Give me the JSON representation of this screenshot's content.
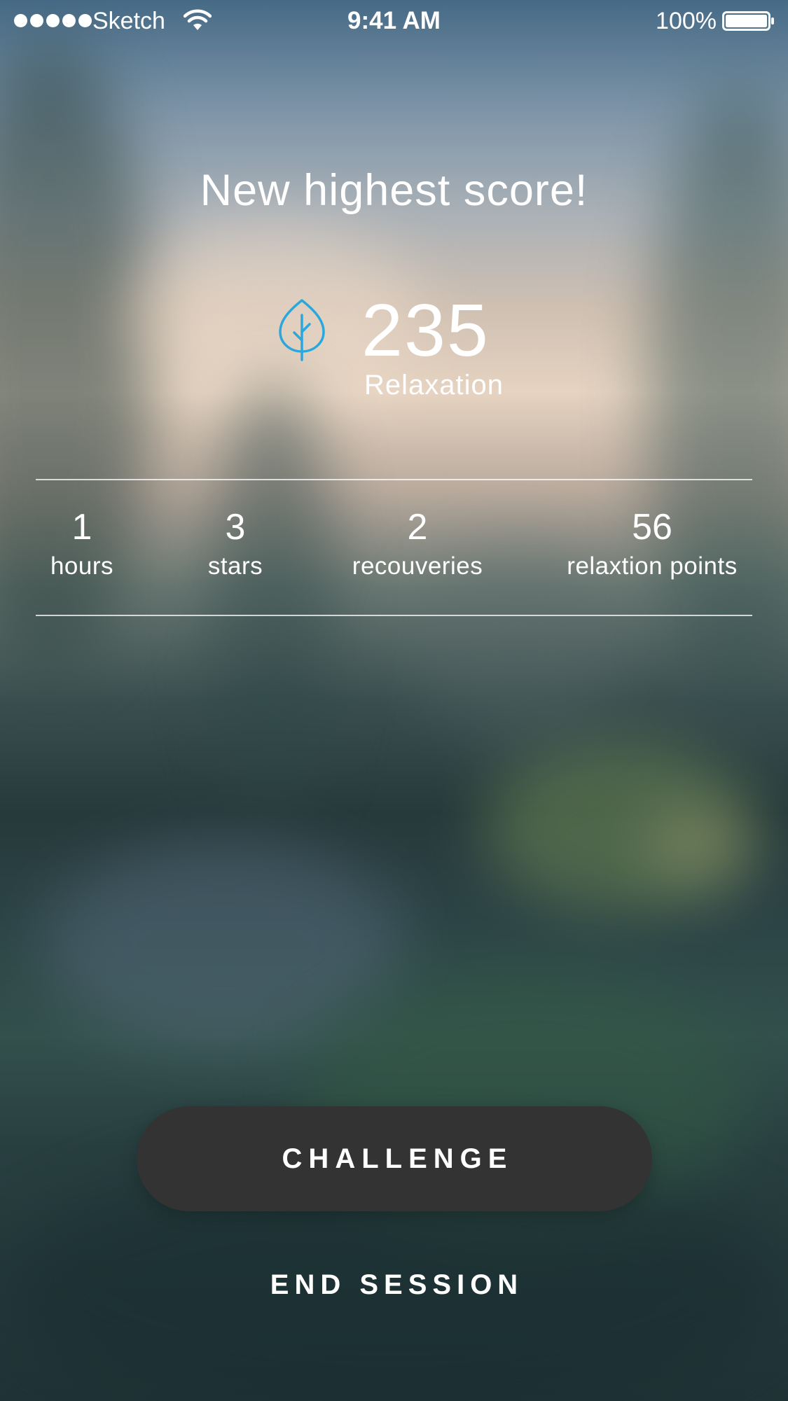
{
  "status_bar": {
    "carrier": "Sketch",
    "time": "9:41 AM",
    "battery_percent": "100%",
    "signal_icon": "signal-dots-icon",
    "wifi_icon": "wifi-icon",
    "battery_icon": "battery-full-icon"
  },
  "headline": "New highest score!",
  "score": {
    "icon": "leaf-icon",
    "icon_color": "#2aa7dc",
    "value": "235",
    "label": "Relaxation"
  },
  "stats": [
    {
      "value": "1",
      "label": "hours"
    },
    {
      "value": "3",
      "label": "stars"
    },
    {
      "value": "2",
      "label": "recouveries"
    },
    {
      "value": "56",
      "label": "relaxtion points"
    }
  ],
  "actions": {
    "challenge_label": "CHALLENGE",
    "end_session_label": "END SESSION",
    "challenge_color": "#333333"
  }
}
